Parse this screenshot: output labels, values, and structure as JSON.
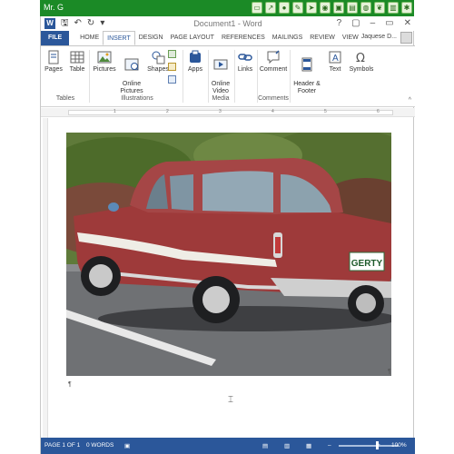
{
  "overlay": {
    "title": "Mr. G"
  },
  "window": {
    "title": "Document1 - Word",
    "controls": [
      "?",
      "▢",
      "–",
      "▭",
      "✕"
    ],
    "user": "Jaquese D..."
  },
  "tabs": [
    {
      "label": "FILE"
    },
    {
      "label": "HOME"
    },
    {
      "label": "INSERT",
      "active": true
    },
    {
      "label": "DESIGN"
    },
    {
      "label": "PAGE LAYOUT"
    },
    {
      "label": "REFERENCES"
    },
    {
      "label": "MAILINGS"
    },
    {
      "label": "REVIEW"
    },
    {
      "label": "VIEW"
    }
  ],
  "ribbon": {
    "pages": "Pages",
    "table": "Table",
    "pictures": "Pictures",
    "online_pictures": "Online\nPictures",
    "shapes": "Shapes",
    "apps": "Apps",
    "online_video": "Online\nVideo",
    "links": "Links",
    "comment": "Comment",
    "header_footer": "Header &\nFooter",
    "text": "Text",
    "symbols": "Symbols",
    "groups": {
      "tables": "Tables",
      "illustrations": "Illustrations",
      "media": "Media",
      "comments": "Comments"
    }
  },
  "ruler": {
    "ticks": [
      "1",
      "2",
      "3",
      "4",
      "5",
      "6"
    ]
  },
  "document": {
    "plate": "GERTY"
  },
  "status": {
    "page": "PAGE 1 OF 1",
    "words": "0 WORDS",
    "zoom": "100%",
    "zoom_level": 0.62
  },
  "colors": {
    "accent": "#2b579a",
    "overlay": "#1b8a26",
    "car_body": "#9e3a3a",
    "car_roof": "#a54646"
  }
}
